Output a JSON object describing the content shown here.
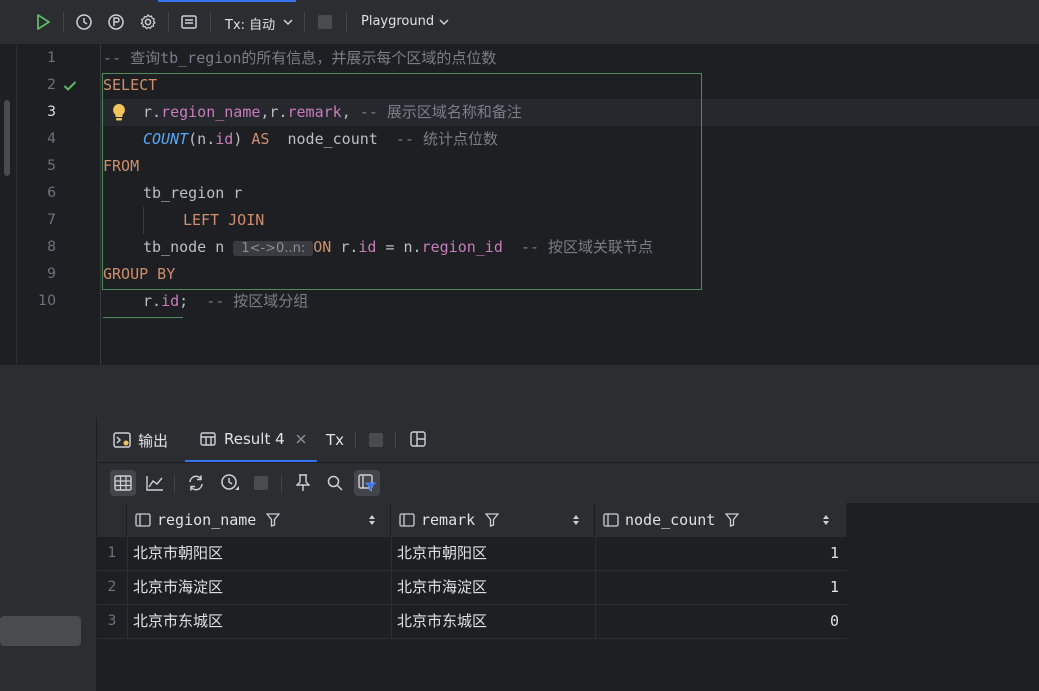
{
  "toolbar": {
    "tx_label": "Tx: 自动",
    "schema_label": "Playground"
  },
  "editor": {
    "line_numbers": [
      "1",
      "2",
      "3",
      "4",
      "5",
      "6",
      "7",
      "8",
      "9",
      "10"
    ],
    "comment_line1": "-- 查询tb_region的所有信息，并展示每个区域的点位数",
    "kw_select": "SELECT",
    "l3_r1": "r.",
    "l3_f1": "region_name",
    "l3_r2": ",r.",
    "l3_f2": "remark",
    "l3_comma": ",",
    "l3_comment": "-- 展示区域名称和备注",
    "l4_fn": "COUNT",
    "l4_p1": "(n.",
    "l4_f": "id",
    "l4_p2": ")",
    "l4_as": "AS",
    "l4_alias": "node_count",
    "l4_comment": "-- 统计点位数",
    "kw_from": "FROM",
    "l6_text": "tb_region r",
    "kw_left_join": "LEFT JOIN",
    "l8_text": "tb_node n",
    "l8_hint": "1<->0..n:",
    "l8_on": "ON",
    "l8_r": "r.",
    "l8_f1": "id",
    "l8_eq": " = n.",
    "l8_f2": "region_id",
    "l8_comment": "-- 按区域关联节点",
    "kw_group_by": "GROUP BY",
    "l10_r": "r.",
    "l10_f": "id",
    "l10_semi": ";",
    "l10_comment": "-- 按区域分组"
  },
  "results": {
    "tabs": [
      {
        "label": "输出"
      },
      {
        "label": "Result 4"
      },
      {
        "label": "Tx"
      }
    ],
    "columns": [
      "region_name",
      "remark",
      "node_count"
    ],
    "rows": [
      {
        "num": "1",
        "region_name": "北京市朝阳区",
        "remark": "北京市朝阳区",
        "node_count": "1"
      },
      {
        "num": "2",
        "region_name": "北京市海淀区",
        "remark": "北京市海淀区",
        "node_count": "1"
      },
      {
        "num": "3",
        "region_name": "北京市东城区",
        "remark": "北京市东城区",
        "node_count": "0"
      }
    ]
  },
  "colors": {
    "keyword": "#cf8e6d",
    "field": "#c77dbb",
    "function": "#56a8f5",
    "comment": "#7a7e85",
    "accent": "#3574f0",
    "run_green": "#5fb865"
  }
}
